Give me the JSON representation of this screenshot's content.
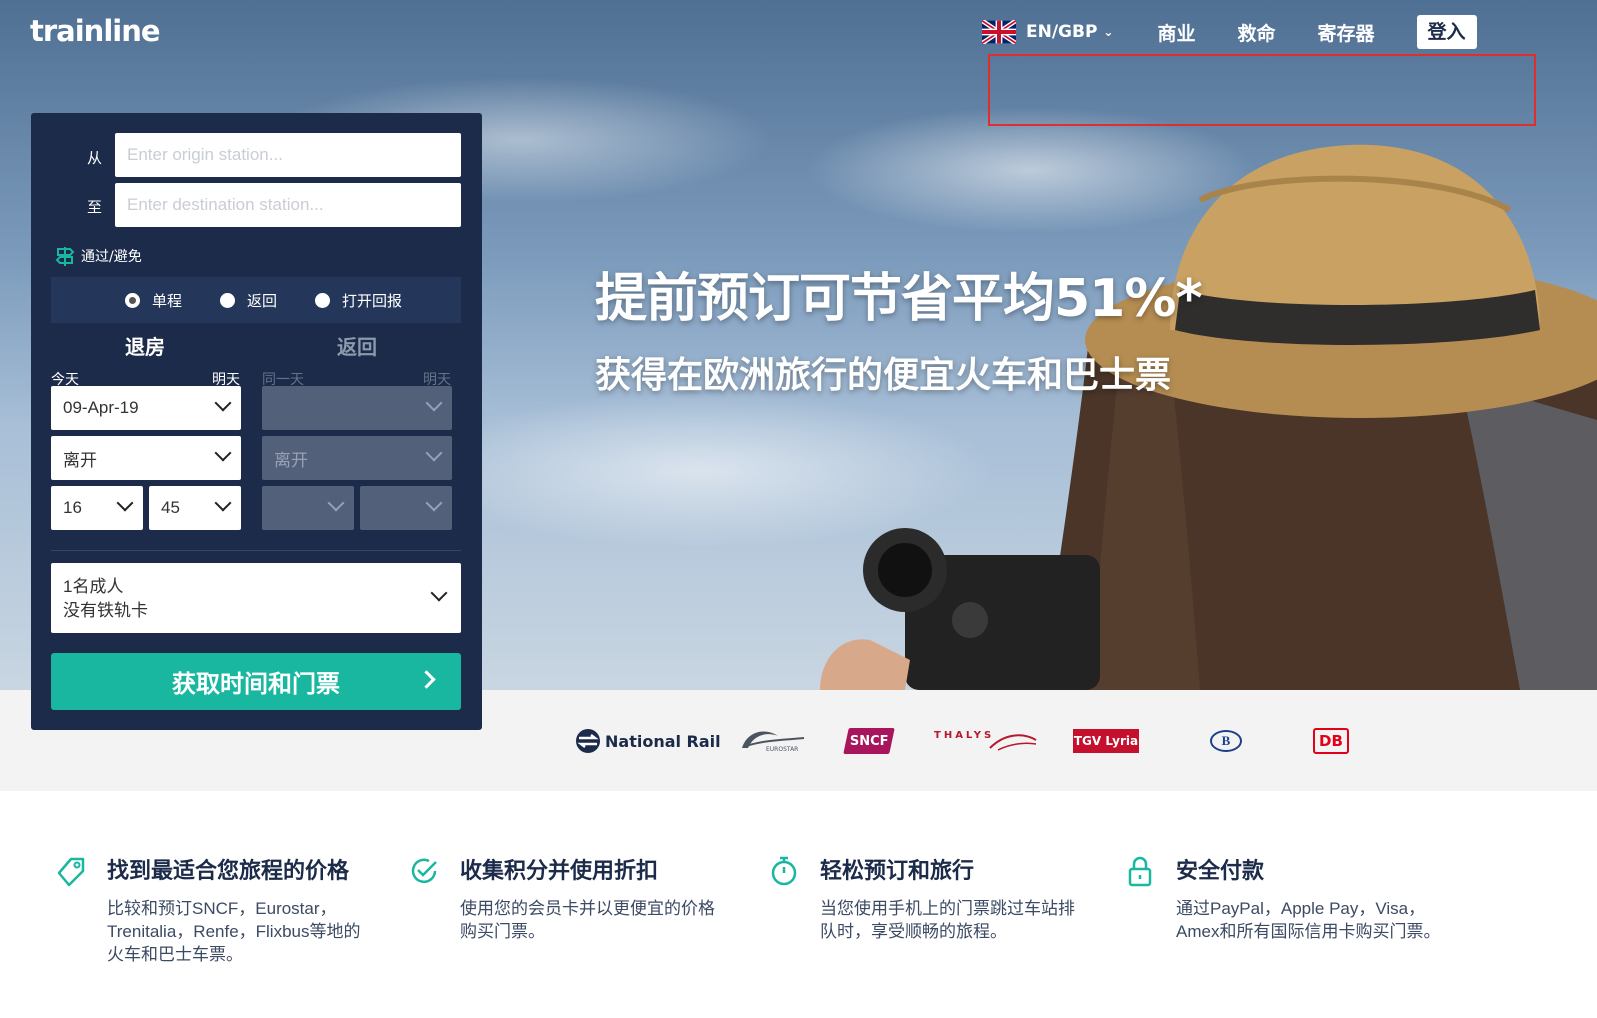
{
  "header": {
    "logo": "trainline",
    "language": "EN/GBP",
    "nav": [
      "商业",
      "救命",
      "寄存器"
    ],
    "login": "登入"
  },
  "hero": {
    "headline": "提前预订可节省平均51%*",
    "subline": "获得在欧洲旅行的便宜火车和巴士票"
  },
  "search": {
    "from_label": "从",
    "to_label": "至",
    "origin_placeholder": "Enter origin station...",
    "destination_placeholder": "Enter destination station...",
    "via_label": "通过/避免",
    "trip_types": [
      "单程",
      "返回",
      "打开回报"
    ],
    "selected_trip_type": "单程",
    "outbound_heading": "退房",
    "return_heading": "返回",
    "outbound_prev": "今天",
    "outbound_next": "明天",
    "return_prev": "同一天",
    "return_next": "明天",
    "outbound_date": "09-Apr-19",
    "outbound_mode": "离开",
    "outbound_hour": "16",
    "outbound_minute": "45",
    "return_mode": "离开",
    "passengers_line1": "1名成人",
    "passengers_line2": "没有铁轨卡",
    "submit": "获取时间和门票"
  },
  "partners": [
    "National Rail",
    "EUROSTAR",
    "SNCF",
    "THALYS",
    "TGV Lyria",
    "B",
    "DB"
  ],
  "features": [
    {
      "icon": "price-tag-icon",
      "title": "找到最适合您旅程的价格",
      "desc": "比较和预订SNCF，Eurostar，Trenitalia，Renfe，Flixbus等地的火车和巴士车票。"
    },
    {
      "icon": "check-circle-icon",
      "title": "收集积分并使用折扣",
      "desc": "使用您的会员卡并以更便宜的价格购买门票。"
    },
    {
      "icon": "stopwatch-icon",
      "title": "轻松预订和旅行",
      "desc": "当您使用手机上的门票跳过车站排队时，享受顺畅的旅程。"
    },
    {
      "icon": "padlock-icon",
      "title": "安全付款",
      "desc": "通过PayPal，Apple Pay，Visa，Amex和所有国际信用卡购买门票。"
    }
  ],
  "colors": {
    "navy": "#1c2b4a",
    "teal": "#1ab7a0",
    "highlight_box": "#e02d2d"
  }
}
